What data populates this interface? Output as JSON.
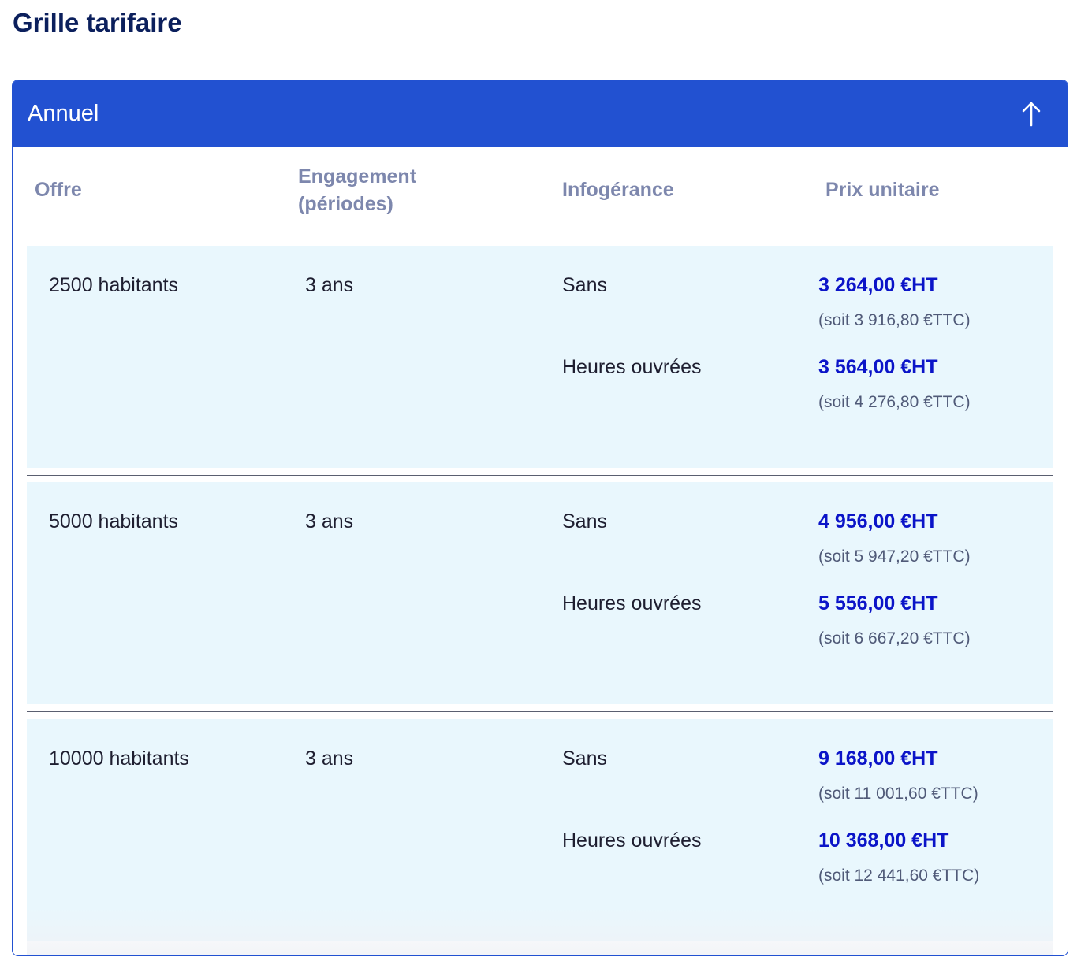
{
  "page": {
    "title": "Grille tarifaire"
  },
  "accordion": {
    "title": "Annuel",
    "icon": "arrow-up-icon",
    "expanded": true,
    "header_color": "#2251d1"
  },
  "table": {
    "headers": {
      "offre": "Offre",
      "engagement": "Engagement (périodes)",
      "infogerance": "Infogérance",
      "prix": "Prix unitaire"
    },
    "rows": [
      {
        "offre": "2500 habitants",
        "engagement": "3 ans",
        "options": [
          {
            "infogerance": "Sans",
            "price_ht": "3 264,00 €HT",
            "price_ttc": "(soit 3 916,80 €TTC)"
          },
          {
            "infogerance": "Heures ouvrées",
            "price_ht": "3 564,00 €HT",
            "price_ttc": "(soit 4 276,80 €TTC)"
          }
        ]
      },
      {
        "offre": "5000 habitants",
        "engagement": "3 ans",
        "options": [
          {
            "infogerance": "Sans",
            "price_ht": "4 956,00 €HT",
            "price_ttc": "(soit 5 947,20 €TTC)"
          },
          {
            "infogerance": "Heures ouvrées",
            "price_ht": "5 556,00 €HT",
            "price_ttc": "(soit 6 667,20 €TTC)"
          }
        ]
      },
      {
        "offre": "10000 habitants",
        "engagement": "3 ans",
        "options": [
          {
            "infogerance": "Sans",
            "price_ht": "9 168,00 €HT",
            "price_ttc": "(soit 11 001,60 €TTC)"
          },
          {
            "infogerance": "Heures ouvrées",
            "price_ht": "10 368,00 €HT",
            "price_ttc": "(soit 12 441,60 €TTC)"
          }
        ]
      }
    ]
  },
  "colors": {
    "accent": "#2251d1",
    "price": "#0b14c8",
    "row_bg": "#e9f7fd",
    "title": "#0b1f5c"
  }
}
